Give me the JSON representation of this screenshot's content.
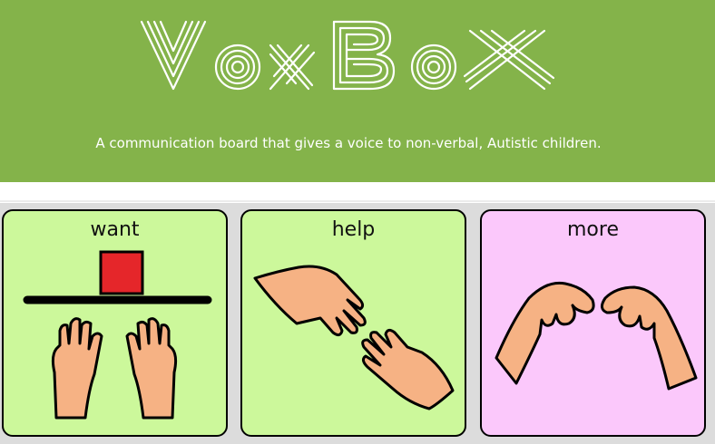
{
  "header": {
    "title": "VoxBox",
    "tagline": "A communication board that gives a voice to non-verbal, Autistic children."
  },
  "colors": {
    "header_bg": "#84b34a",
    "card_green": "#ccf89b",
    "card_pink": "#fbc8fb",
    "skin": "#f6b284",
    "block_red": "#e5262a"
  },
  "cards": [
    {
      "label": "want",
      "icon": "want-hands-icon"
    },
    {
      "label": "help",
      "icon": "help-hands-icon"
    },
    {
      "label": "more",
      "icon": "more-hands-icon"
    }
  ]
}
